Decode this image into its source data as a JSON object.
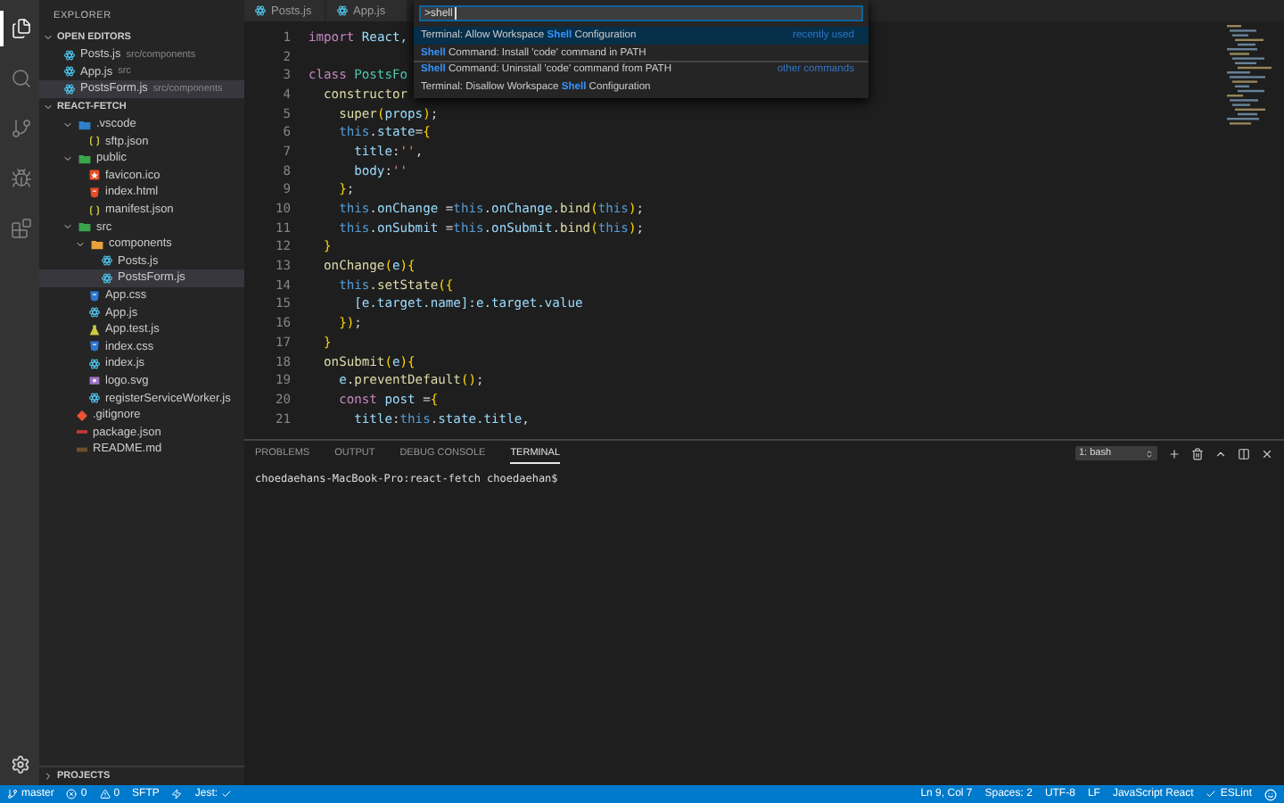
{
  "activity_bar": {
    "items": [
      {
        "kind": "files",
        "selected": true
      },
      {
        "kind": "search",
        "selected": false
      },
      {
        "kind": "git",
        "selected": false
      },
      {
        "kind": "debug",
        "selected": false
      },
      {
        "kind": "extensions",
        "selected": false
      }
    ]
  },
  "sidebar": {
    "title": "EXPLORER",
    "open_editors": {
      "title": "OPEN EDITORS",
      "expanded": true,
      "items": [
        {
          "name": "Posts.js",
          "path": "src/components",
          "kind": "react",
          "selected": false
        },
        {
          "name": "App.js",
          "path": "src",
          "kind": "react",
          "selected": false
        },
        {
          "name": "PostsForm.js",
          "path": "src/components",
          "kind": "react",
          "selected": true
        }
      ]
    },
    "folder": {
      "title": "REACT-FETCH",
      "expanded": true,
      "items": [
        {
          "name": ".vscode",
          "kind": "folder-vscode",
          "expanded": true,
          "selected": false,
          "children": [
            {
              "name": "sftp.json",
              "kind": "json",
              "selected": false
            }
          ]
        },
        {
          "name": "public",
          "kind": "folder-public",
          "expanded": true,
          "selected": false,
          "children": [
            {
              "name": "favicon.ico",
              "kind": "favicon",
              "selected": false
            },
            {
              "name": "index.html",
              "kind": "html",
              "selected": false
            },
            {
              "name": "manifest.json",
              "kind": "json",
              "selected": false
            }
          ]
        },
        {
          "name": "src",
          "kind": "folder-src",
          "expanded": true,
          "selected": false,
          "children": [
            {
              "name": "components",
              "kind": "folder-components",
              "expanded": true,
              "selected": false,
              "children": [
                {
                  "name": "Posts.js",
                  "kind": "react",
                  "selected": false
                },
                {
                  "name": "PostsForm.js",
                  "kind": "react",
                  "selected": true
                }
              ]
            },
            {
              "name": "App.css",
              "kind": "css",
              "selected": false
            },
            {
              "name": "App.js",
              "kind": "react",
              "selected": false
            },
            {
              "name": "App.test.js",
              "kind": "test",
              "selected": false
            },
            {
              "name": "index.css",
              "kind": "css",
              "selected": false
            },
            {
              "name": "index.js",
              "kind": "react",
              "selected": false
            },
            {
              "name": "logo.svg",
              "kind": "svg",
              "selected": false
            },
            {
              "name": "registerServiceWorker.js",
              "kind": "react",
              "selected": false
            }
          ]
        },
        {
          "name": ".gitignore",
          "kind": "git",
          "selected": false
        },
        {
          "name": "package.json",
          "kind": "npm",
          "selected": false
        },
        {
          "name": "README.md",
          "kind": "md",
          "selected": false
        }
      ]
    },
    "projects": {
      "title": "PROJECTS",
      "expanded": false
    }
  },
  "editor": {
    "tabs": [
      {
        "label": "Posts.js",
        "selected": false
      },
      {
        "label": "App.js",
        "selected": false
      }
    ],
    "lines": [
      {
        "n": "1",
        "tokens": [
          {
            "kind": "keyword",
            "t": "import "
          },
          {
            "kind": "name",
            "t": "React,"
          }
        ]
      },
      {
        "n": "2"
      },
      {
        "n": "3",
        "tokens": [
          {
            "kind": "keyword",
            "t": "class "
          },
          {
            "kind": "class",
            "t": "PostsFo"
          }
        ]
      },
      {
        "n": "4",
        "tokens": [
          {
            "kind": "func",
            "t": "  constructor"
          }
        ]
      },
      {
        "n": "5",
        "tokens": [
          {
            "kind": "func",
            "t": "    super"
          },
          {
            "kind": "brace",
            "t": "("
          },
          {
            "kind": "name",
            "t": "props"
          },
          {
            "kind": "brace",
            "t": ")"
          },
          {
            "kind": "plain",
            "t": ";"
          }
        ]
      },
      {
        "n": "6",
        "tokens": [
          {
            "kind": "this",
            "t": "    this"
          },
          {
            "kind": "plain",
            "t": "."
          },
          {
            "kind": "name",
            "t": "state"
          },
          {
            "kind": "plain",
            "t": "="
          },
          {
            "kind": "brace",
            "t": "{"
          }
        ]
      },
      {
        "n": "7",
        "tokens": [
          {
            "kind": "name",
            "t": "      title"
          },
          {
            "kind": "plain",
            "t": ":"
          },
          {
            "kind": "string",
            "t": "''"
          },
          {
            "kind": "plain",
            "t": ","
          }
        ]
      },
      {
        "n": "8",
        "tokens": [
          {
            "kind": "name",
            "t": "      body"
          },
          {
            "kind": "plain",
            "t": ":"
          },
          {
            "kind": "string",
            "t": "''"
          }
        ]
      },
      {
        "n": "9",
        "tokens": [
          {
            "kind": "brace",
            "t": "    }"
          },
          {
            "kind": "plain",
            "t": ";"
          }
        ]
      },
      {
        "n": "10",
        "tokens": [
          {
            "kind": "this",
            "t": "    this"
          },
          {
            "kind": "plain",
            "t": "."
          },
          {
            "kind": "name",
            "t": "onChange"
          },
          {
            "kind": "plain",
            "t": " ="
          },
          {
            "kind": "this",
            "t": "this"
          },
          {
            "kind": "plain",
            "t": "."
          },
          {
            "kind": "name",
            "t": "onChange"
          },
          {
            "kind": "plain",
            "t": "."
          },
          {
            "kind": "func",
            "t": "bind"
          },
          {
            "kind": "brace",
            "t": "("
          },
          {
            "kind": "this",
            "t": "this"
          },
          {
            "kind": "brace",
            "t": ")"
          },
          {
            "kind": "plain",
            "t": ";"
          }
        ]
      },
      {
        "n": "11",
        "tokens": [
          {
            "kind": "this",
            "t": "    this"
          },
          {
            "kind": "plain",
            "t": "."
          },
          {
            "kind": "name",
            "t": "onSubmit"
          },
          {
            "kind": "plain",
            "t": " ="
          },
          {
            "kind": "this",
            "t": "this"
          },
          {
            "kind": "plain",
            "t": "."
          },
          {
            "kind": "name",
            "t": "onSubmit"
          },
          {
            "kind": "plain",
            "t": "."
          },
          {
            "kind": "func",
            "t": "bind"
          },
          {
            "kind": "brace",
            "t": "("
          },
          {
            "kind": "this",
            "t": "this"
          },
          {
            "kind": "brace",
            "t": ")"
          },
          {
            "kind": "plain",
            "t": ";"
          }
        ]
      },
      {
        "n": "12",
        "tokens": [
          {
            "kind": "brace",
            "t": "  }"
          }
        ]
      },
      {
        "n": "13",
        "tokens": [
          {
            "kind": "func",
            "t": "  onChange"
          },
          {
            "kind": "brace",
            "t": "("
          },
          {
            "kind": "name",
            "t": "e"
          },
          {
            "kind": "brace",
            "t": "){"
          }
        ]
      },
      {
        "n": "14",
        "tokens": [
          {
            "kind": "this",
            "t": "    this"
          },
          {
            "kind": "func",
            "t": ".setState"
          },
          {
            "kind": "brace",
            "t": "({"
          }
        ]
      },
      {
        "n": "15",
        "tokens": [
          {
            "kind": "name",
            "t": "      [e.target.name]:e.target.value"
          }
        ]
      },
      {
        "n": "16",
        "tokens": [
          {
            "kind": "brace",
            "t": "    })"
          },
          {
            "kind": "plain",
            "t": ";"
          }
        ]
      },
      {
        "n": "17",
        "tokens": [
          {
            "kind": "brace",
            "t": "  }"
          }
        ]
      },
      {
        "n": "18",
        "tokens": [
          {
            "kind": "func",
            "t": "  onSubmit"
          },
          {
            "kind": "brace",
            "t": "("
          },
          {
            "kind": "name",
            "t": "e"
          },
          {
            "kind": "brace",
            "t": "){"
          }
        ]
      },
      {
        "n": "19",
        "tokens": [
          {
            "kind": "name",
            "t": "    e"
          },
          {
            "kind": "plain",
            "t": "."
          },
          {
            "kind": "func",
            "t": "preventDefault"
          },
          {
            "kind": "brace",
            "t": "()"
          },
          {
            "kind": "plain",
            "t": ";"
          }
        ]
      },
      {
        "n": "20",
        "tokens": [
          {
            "kind": "keyword",
            "t": "    const "
          },
          {
            "kind": "name",
            "t": "post"
          },
          {
            "kind": "plain",
            "t": " ="
          },
          {
            "kind": "brace",
            "t": "{"
          }
        ]
      },
      {
        "n": "21",
        "tokens": [
          {
            "kind": "name",
            "t": "      title"
          },
          {
            "kind": "plain",
            "t": ":"
          },
          {
            "kind": "this",
            "t": "this"
          },
          {
            "kind": "plain",
            "t": "."
          },
          {
            "kind": "name",
            "t": "state.title"
          },
          {
            "kind": "plain",
            "t": ","
          }
        ]
      }
    ]
  },
  "command_palette": {
    "value": ">shell",
    "items": [
      {
        "label": "Terminal: Allow Workspace **Shell** Configuration",
        "detail": "recently used",
        "selected": true,
        "separator": false
      },
      {
        "label": "**Shell** Command: Install 'code' command in PATH",
        "selected": false,
        "separator": false
      },
      {
        "label": "**Shell** Command: Uninstall 'code' command from PATH",
        "detail": "other commands",
        "selected": false,
        "separator": true
      },
      {
        "label": "Terminal: Disallow Workspace **Shell** Configuration",
        "selected": false,
        "separator": false
      }
    ]
  },
  "panel": {
    "tabs": [
      {
        "label": "PROBLEMS",
        "selected": false
      },
      {
        "label": "OUTPUT",
        "selected": false
      },
      {
        "label": "DEBUG CONSOLE",
        "selected": false
      },
      {
        "label": "TERMINAL",
        "selected": true
      }
    ],
    "terminal_select": "1: bash",
    "actions": [
      {
        "kind": "add"
      },
      {
        "kind": "trash"
      },
      {
        "kind": "maximize"
      },
      {
        "kind": "split"
      },
      {
        "kind": "close"
      }
    ],
    "terminal_lines": [
      "choedaehans-MacBook-Pro:react-fetch choedaehan$"
    ]
  },
  "status_bar": {
    "left": [
      {
        "kind": "branch",
        "text": "master"
      },
      {
        "kind": "errors",
        "text": "0"
      },
      {
        "kind": "warnings",
        "text": "0"
      },
      {
        "kind": "text",
        "text": "SFTP"
      },
      {
        "kind": "bolt"
      },
      {
        "kind": "jest",
        "text": "Jest:"
      }
    ],
    "right": [
      {
        "kind": "text",
        "text": "Ln 9, Col 7"
      },
      {
        "kind": "text",
        "text": "Spaces: 2"
      },
      {
        "kind": "text",
        "text": "UTF-8"
      },
      {
        "kind": "text",
        "text": "LF"
      },
      {
        "kind": "text",
        "text": "JavaScript React"
      },
      {
        "kind": "eslint",
        "text": "ESLint"
      },
      {
        "kind": "feedback"
      }
    ]
  }
}
